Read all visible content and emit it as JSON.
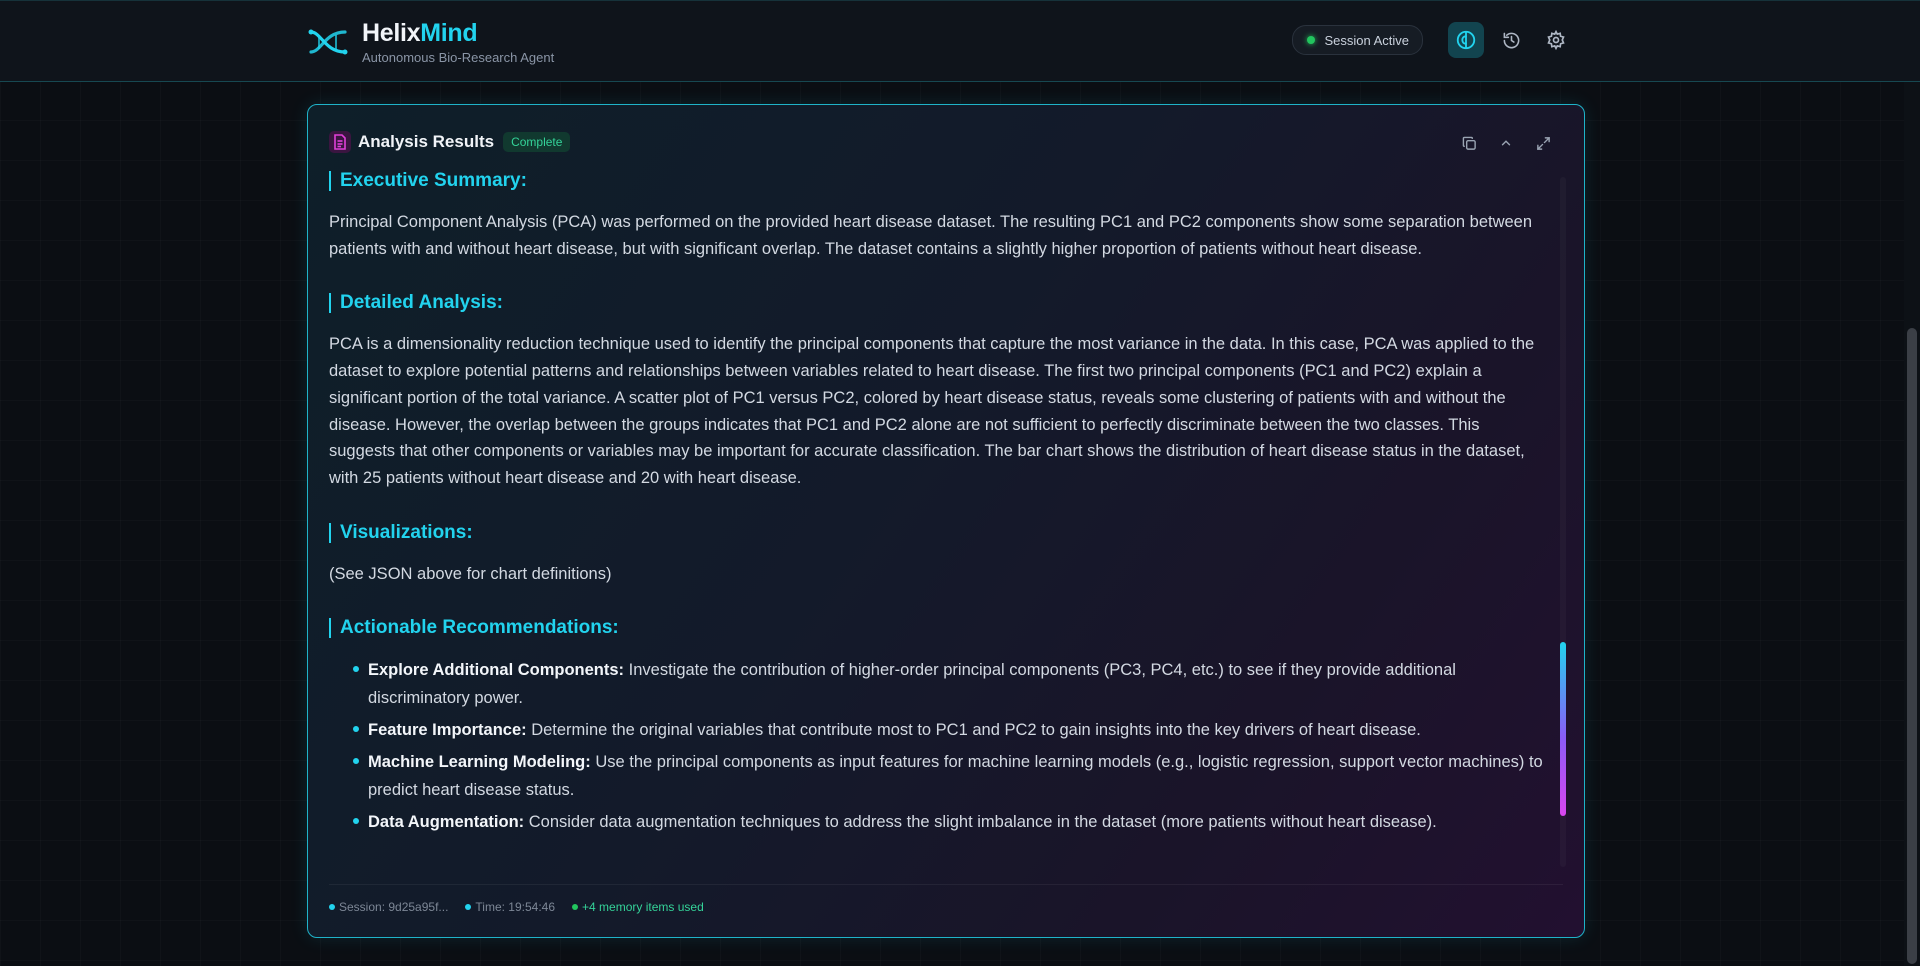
{
  "header": {
    "brand_main": "Helix",
    "brand_accent": "Mind",
    "subtitle": "Autonomous Bio-Research Agent",
    "session_status": "Session Active",
    "icons": [
      "brain-icon",
      "history-icon",
      "gear-icon"
    ]
  },
  "card": {
    "title": "Analysis Results",
    "badge": "Complete",
    "actions": [
      "copy-icon",
      "chevron-up-icon",
      "expand-icon"
    ]
  },
  "sections": {
    "executive": {
      "heading": "Executive Summary:",
      "text": "Principal Component Analysis (PCA) was performed on the provided heart disease dataset. The resulting PC1 and PC2 components show some separation between patients with and without heart disease, but with significant overlap. The dataset contains a slightly higher proportion of patients without heart disease."
    },
    "detailed": {
      "heading": "Detailed Analysis:",
      "text": "PCA is a dimensionality reduction technique used to identify the principal components that capture the most variance in the data. In this case, PCA was applied to the dataset to explore potential patterns and relationships between variables related to heart disease. The first two principal components (PC1 and PC2) explain a significant portion of the total variance. A scatter plot of PC1 versus PC2, colored by heart disease status, reveals some clustering of patients with and without the disease. However, the overlap between the groups indicates that PC1 and PC2 alone are not sufficient to perfectly discriminate between the two classes. This suggests that other components or variables may be important for accurate classification. The bar chart shows the distribution of heart disease status in the dataset, with 25 patients without heart disease and 20 with heart disease."
    },
    "visualizations": {
      "heading": "Visualizations:",
      "text": "(See JSON above for chart definitions)"
    },
    "recommendations": {
      "heading": "Actionable Recommendations:",
      "items": [
        {
          "title": "Explore Additional Components:",
          "text": " Investigate the contribution of higher-order principal components (PC3, PC4, etc.) to see if they provide additional discriminatory power."
        },
        {
          "title": "Feature Importance:",
          "text": " Determine the original variables that contribute most to PC1 and PC2 to gain insights into the key drivers of heart disease."
        },
        {
          "title": "Machine Learning Modeling:",
          "text": " Use the principal components as input features for machine learning models (e.g., logistic regression, support vector machines) to predict heart disease status."
        },
        {
          "title": "Data Augmentation:",
          "text": " Consider data augmentation techniques to address the slight imbalance in the dataset (more patients without heart disease)."
        }
      ]
    }
  },
  "footer": {
    "session": "Session: 9d25a95f...",
    "time": "Time: 19:54:46",
    "memory": "+4 memory items used"
  },
  "colors": {
    "accent": "#22d3ee",
    "success": "#22c55e",
    "magenta": "#d946ef"
  }
}
